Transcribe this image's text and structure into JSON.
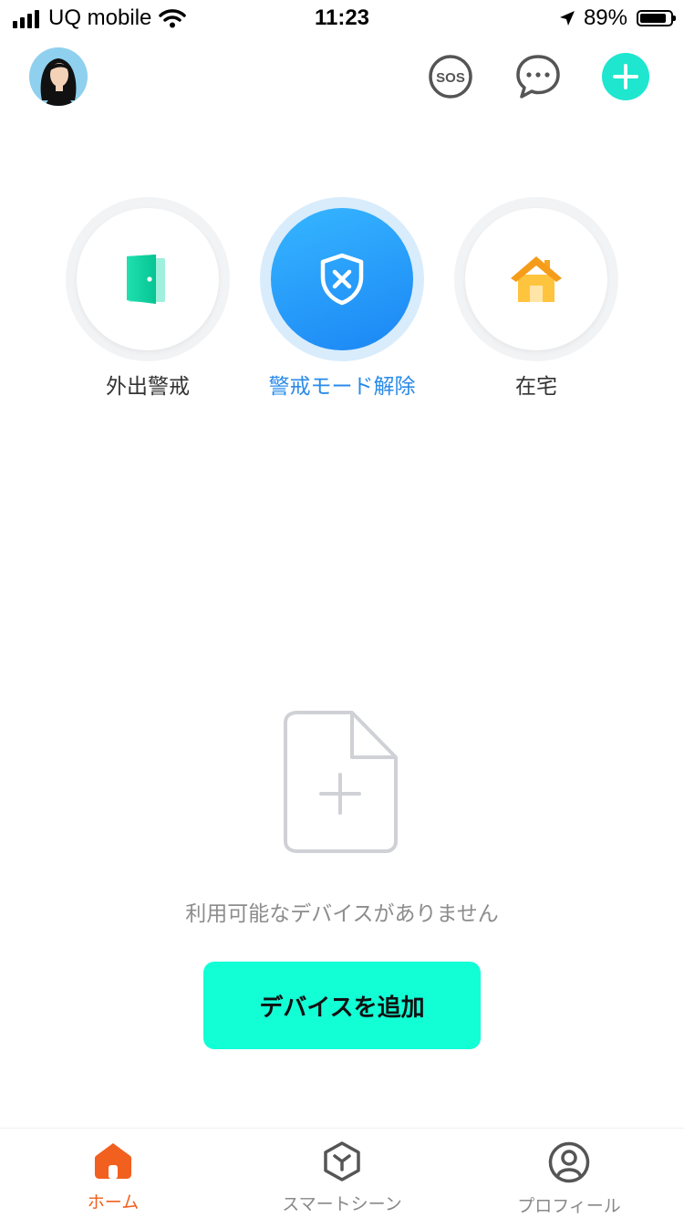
{
  "status_bar": {
    "carrier": "UQ mobile",
    "time": "11:23",
    "battery": "89%",
    "battery_level": 0.89
  },
  "header": {
    "avatar": "user-avatar",
    "sos_label": "SOS",
    "icons": [
      "sos-icon",
      "chat-bubble-icon",
      "plus-icon"
    ],
    "accent_color": "#1ee6cf"
  },
  "modes": [
    {
      "label": "外出警戒",
      "icon": "door-icon",
      "active": false
    },
    {
      "label": "警戒モード解除",
      "icon": "shield-x-icon",
      "active": true
    },
    {
      "label": "在宅",
      "icon": "house-icon",
      "active": false
    }
  ],
  "empty_state": {
    "icon": "add-file-icon",
    "message": "利用可能なデバイスがありません",
    "button_label": "デバイスを追加",
    "button_color": "#12ffd6"
  },
  "tabs": [
    {
      "label": "ホーム",
      "icon": "home-icon",
      "active": true
    },
    {
      "label": "スマートシーン",
      "icon": "scene-cube-icon",
      "active": false
    },
    {
      "label": "プロフィール",
      "icon": "profile-icon",
      "active": false
    }
  ],
  "colors": {
    "active_mode": "#2a8be8",
    "active_tab": "#f2601f"
  }
}
